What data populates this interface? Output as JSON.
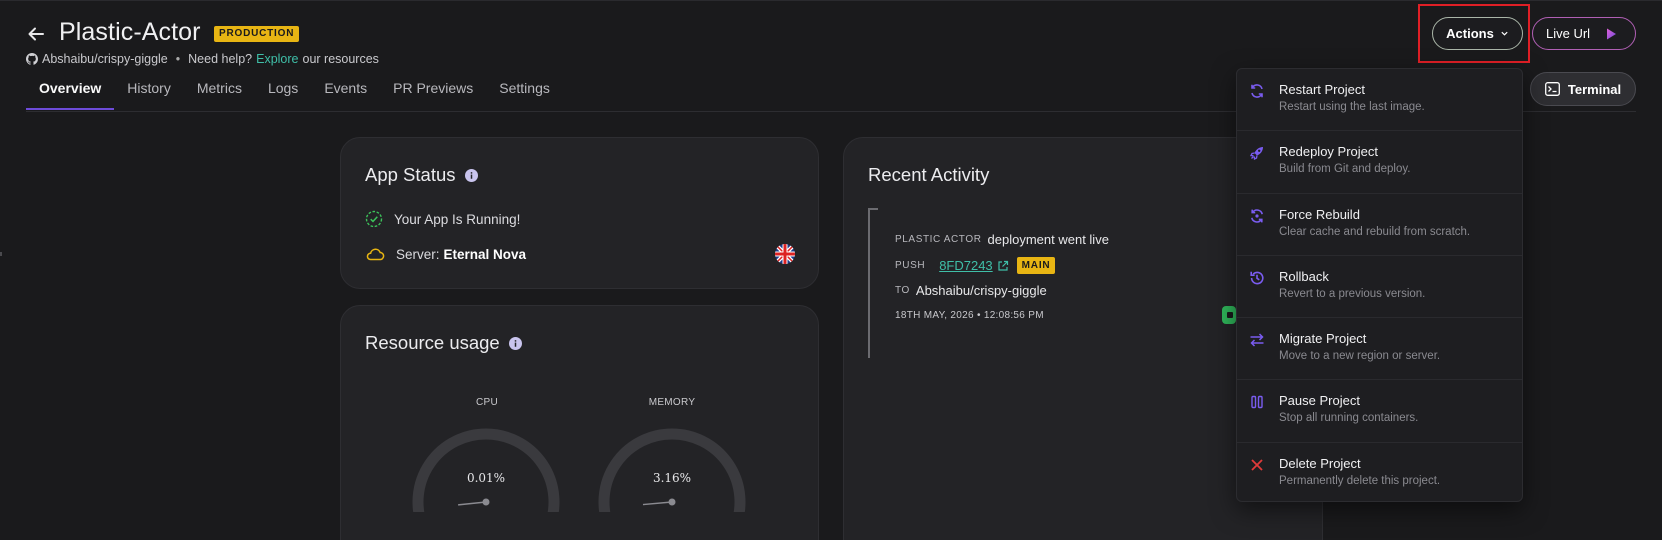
{
  "header": {
    "title": "Plastic-Actor",
    "env_badge": "PRODUCTION",
    "repo": "Abshaibu/crispy-giggle",
    "help_prefix": "Need help?",
    "help_link": "Explore",
    "help_suffix": "our resources"
  },
  "tabs": [
    {
      "label": "Overview",
      "active": true
    },
    {
      "label": "History"
    },
    {
      "label": "Metrics"
    },
    {
      "label": "Logs"
    },
    {
      "label": "Events"
    },
    {
      "label": "PR Previews"
    },
    {
      "label": "Settings"
    }
  ],
  "buttons": {
    "actions": "Actions",
    "live_url": "Live Url",
    "terminal": "Terminal"
  },
  "app_status": {
    "title": "App Status",
    "running_text": "Your App Is Running!",
    "server_label": "Server:",
    "server_name": "Eternal Nova"
  },
  "resource_usage": {
    "title": "Resource usage",
    "cpu_label": "CPU",
    "cpu_value": "0.01%",
    "cpu_fraction": 0.0001,
    "memory_label": "MEMORY",
    "memory_value": "3.16%",
    "memory_fraction": 0.0316
  },
  "activity": {
    "title": "Recent Activity",
    "actor": "PLASTIC ACTOR",
    "event_text": "deployment went live",
    "push_label": "PUSH",
    "commit": "8FD7243",
    "branch": "MAIN",
    "to_label": "TO",
    "repo": "Abshaibu/crispy-giggle",
    "date": "18TH MAY, 2026 • 12:08:56 PM"
  },
  "actions_menu": [
    {
      "label": "Restart Project",
      "desc": "Restart using the last image.",
      "icon": "restart-icon"
    },
    {
      "label": "Redeploy Project",
      "desc": "Build from Git and deploy.",
      "icon": "rocket-icon"
    },
    {
      "label": "Force Rebuild",
      "desc": "Clear cache and rebuild from scratch.",
      "icon": "rebuild-icon"
    },
    {
      "label": "Rollback",
      "desc": "Revert to a previous version.",
      "icon": "history-icon"
    },
    {
      "label": "Migrate Project",
      "desc": "Move to a new region or server.",
      "icon": "swap-arrows-icon"
    },
    {
      "label": "Pause Project",
      "desc": "Stop all running containers.",
      "icon": "pause-icon"
    },
    {
      "label": "Delete Project",
      "desc": "Permanently delete this project.",
      "icon": "close-x-icon"
    }
  ],
  "colors": {
    "background": "#1a1a1c",
    "card": "#232326",
    "accent_purple": "#6d4bd8",
    "badge_yellow": "#e8b513",
    "link_teal": "#3fbfa8",
    "gauge_green": "#4cd137",
    "danger_red": "#e03a3a"
  }
}
